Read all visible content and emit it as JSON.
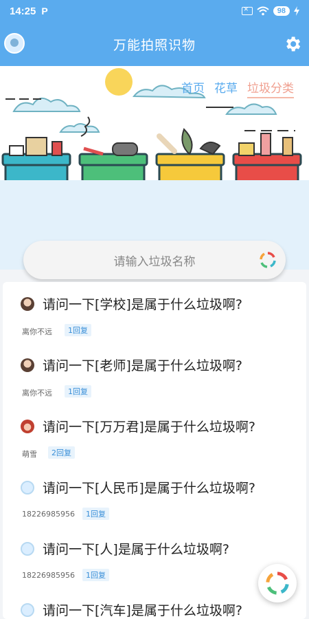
{
  "status": {
    "time": "14:25",
    "carrier_icon": "P",
    "battery": "98"
  },
  "appbar": {
    "title": "万能拍照识物"
  },
  "nav": {
    "items": [
      "首页",
      "花草",
      "垃圾分类"
    ],
    "active": "垃圾分类"
  },
  "search": {
    "placeholder": "请输入垃圾名称"
  },
  "posts": [
    {
      "question": "请问一下[学校]是属于什么垃圾啊?",
      "user": "离你不远",
      "replies": "1回复",
      "avatar": "photo-girl"
    },
    {
      "question": "请问一下[老师]是属于什么垃圾啊?",
      "user": "离你不远",
      "replies": "1回复",
      "avatar": "photo-girl"
    },
    {
      "question": "请问一下[万万君]是属于什么垃圾啊?",
      "user": "萌雪",
      "replies": "2回复",
      "avatar": "cartoon"
    },
    {
      "question": "请问一下[人民币]是属于什么垃圾啊?",
      "user": "18226985956",
      "replies": "1回复",
      "avatar": "default"
    },
    {
      "question": "请问一下[人]是属于什么垃圾啊?",
      "user": "18226985956",
      "replies": "1回复",
      "avatar": "default"
    },
    {
      "question": "请问一下[汽车]是属于什么垃圾啊?",
      "user": "",
      "replies": "",
      "avatar": "default"
    }
  ],
  "colors": {
    "primary": "#5aabee",
    "active_tab": "#f0a090",
    "bin_recyclable": "#3cb7c9",
    "bin_kitchen": "#4dbf7a",
    "bin_other": "#f6c93b",
    "bin_hazardous": "#e84d48"
  }
}
